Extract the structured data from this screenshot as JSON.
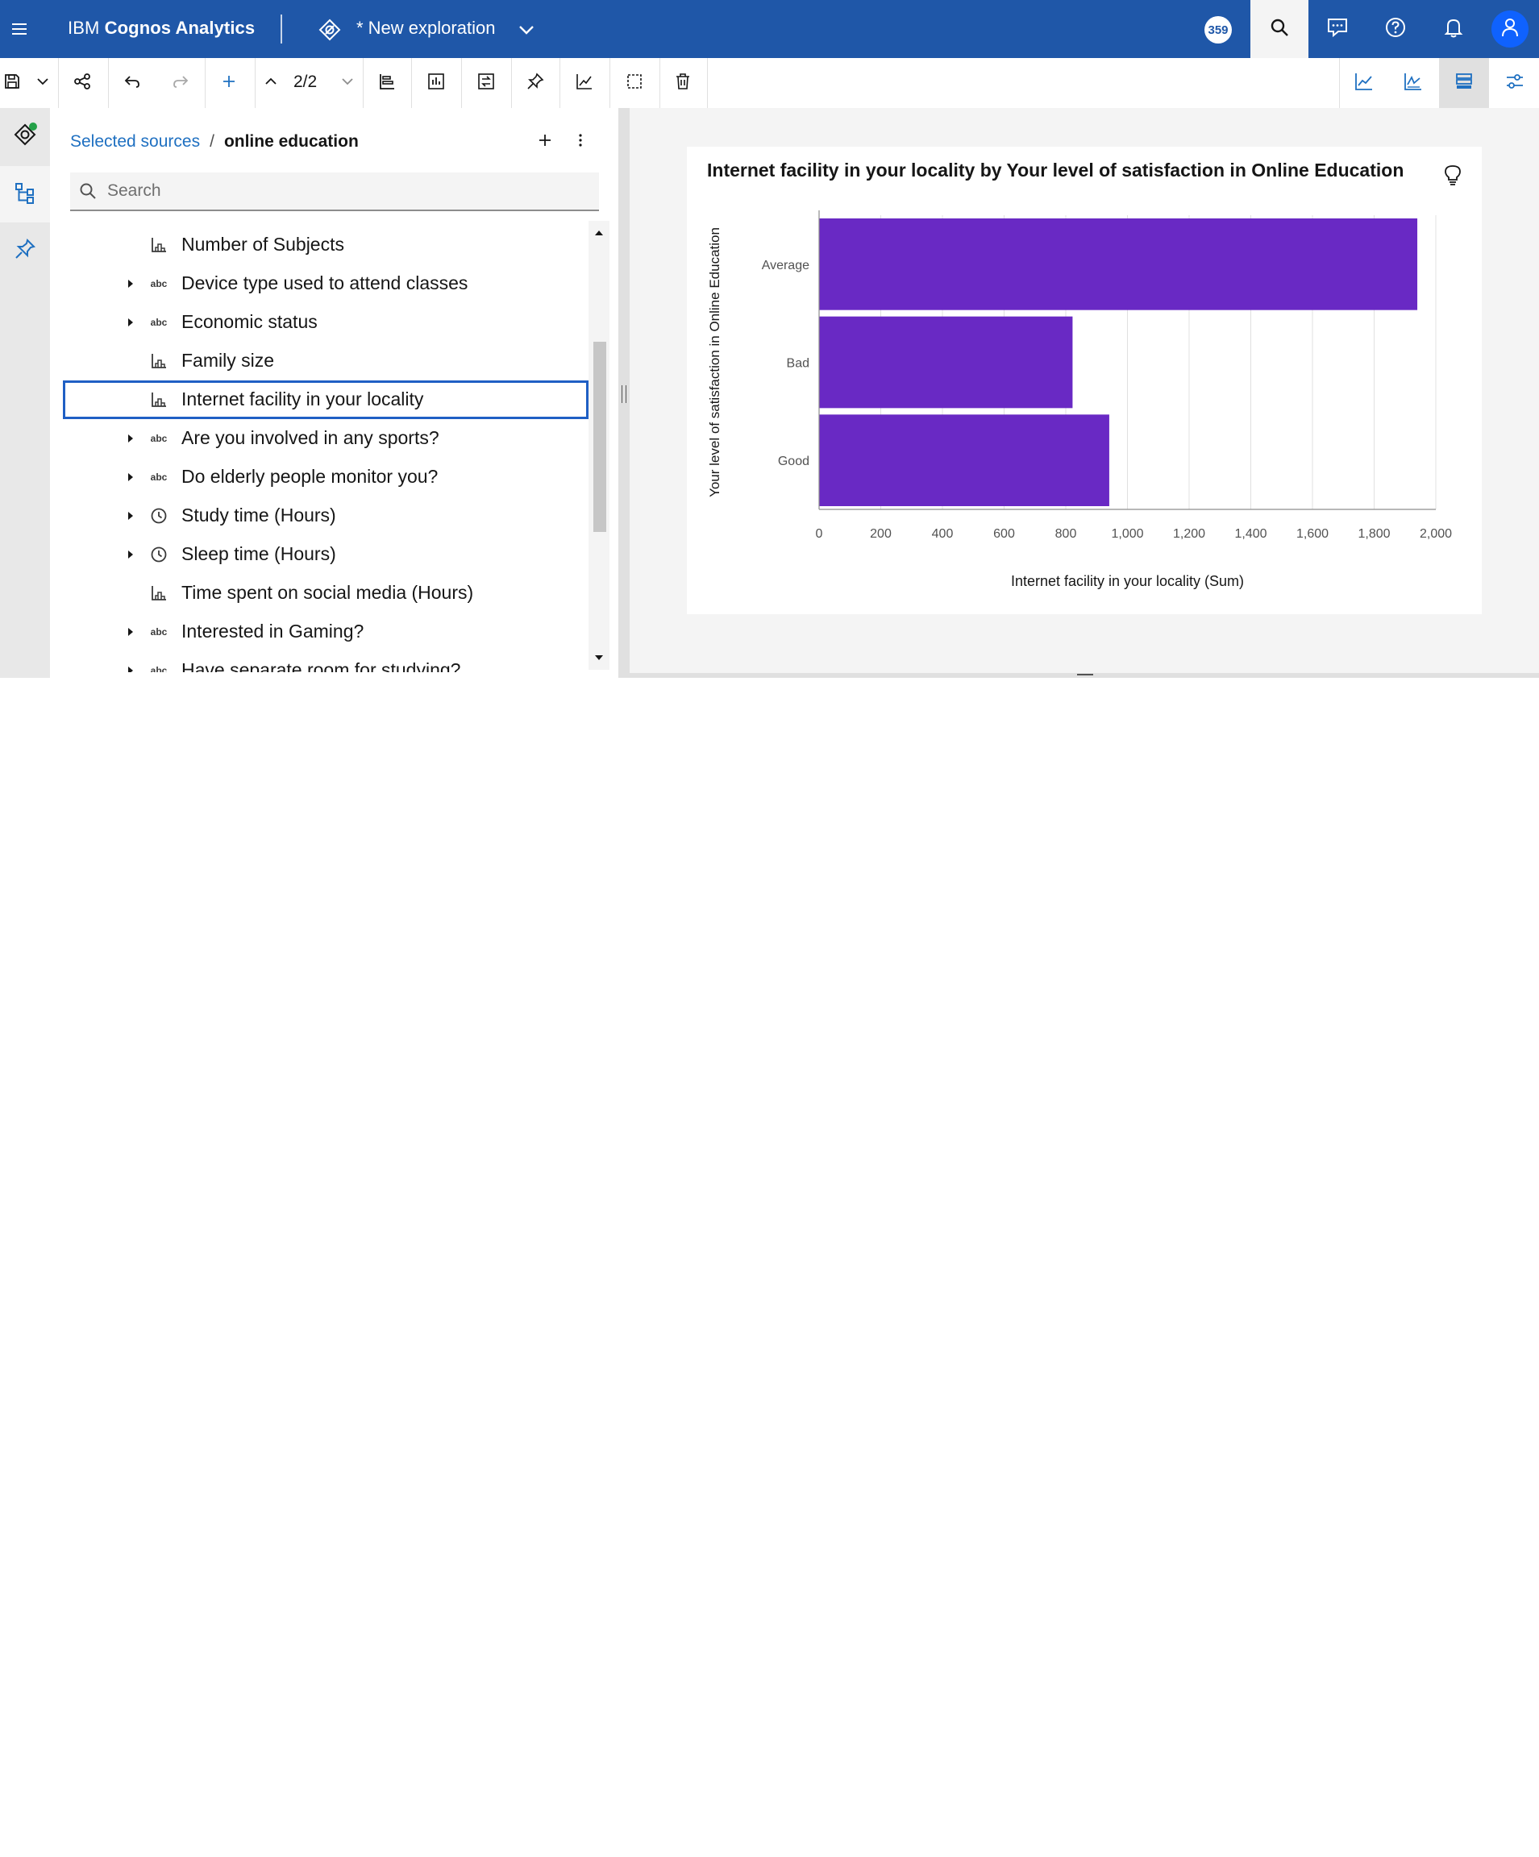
{
  "header": {
    "brand_prefix": "IBM ",
    "brand_name": "Cognos Analytics",
    "exploration_title": "* New exploration",
    "badge": "359"
  },
  "toolbar": {
    "pager": "2/2"
  },
  "source_panel": {
    "breadcrumb_link": "Selected sources",
    "breadcrumb_sep": "/",
    "breadcrumb_current": "online education",
    "search_placeholder": "Search",
    "items": [
      {
        "label": "Number of Subjects",
        "icon": "measure-icon",
        "expandable": false,
        "selected": false
      },
      {
        "label": "Device type used to attend classes",
        "icon": "abc",
        "expandable": true,
        "selected": false
      },
      {
        "label": "Economic status",
        "icon": "abc",
        "expandable": true,
        "selected": false
      },
      {
        "label": "Family size",
        "icon": "measure-icon",
        "expandable": false,
        "selected": false
      },
      {
        "label": "Internet facility in your locality",
        "icon": "measure-icon",
        "expandable": false,
        "selected": true
      },
      {
        "label": "Are you involved in any sports?",
        "icon": "abc",
        "expandable": true,
        "selected": false
      },
      {
        "label": "Do elderly people monitor you?",
        "icon": "abc",
        "expandable": true,
        "selected": false
      },
      {
        "label": "Study time (Hours)",
        "icon": "clock-icon",
        "expandable": true,
        "selected": false
      },
      {
        "label": "Sleep time (Hours)",
        "icon": "clock-icon",
        "expandable": true,
        "selected": false
      },
      {
        "label": "Time spent on social media (Hours)",
        "icon": "measure-icon",
        "expandable": false,
        "selected": false
      },
      {
        "label": "Interested in Gaming?",
        "icon": "abc",
        "expandable": true,
        "selected": false
      },
      {
        "label": "Have separate room for studying?",
        "icon": "abc",
        "expandable": true,
        "selected": false
      }
    ]
  },
  "colors": {
    "header_bg": "#1f57a8",
    "bar": "#6929c4",
    "link": "#1f70c1",
    "selection": "#1f5fc4"
  },
  "chart_data": {
    "type": "bar",
    "orientation": "horizontal",
    "title": "Internet facility in your locality by Your level of satisfaction in Online Education",
    "xlabel": "Internet facility in your locality (Sum)",
    "ylabel": "Your level of satisfaction in Online Education",
    "categories": [
      "Average",
      "Bad",
      "Good"
    ],
    "values": [
      1940,
      822,
      941
    ],
    "xlim": [
      0,
      2000
    ],
    "xticks": [
      0,
      200,
      400,
      600,
      800,
      1000,
      1200,
      1400,
      1600,
      1800,
      2000
    ],
    "xtick_labels": [
      "0",
      "200",
      "400",
      "600",
      "800",
      "1,000",
      "1,200",
      "1,400",
      "1,600",
      "1,800",
      "2,000"
    ],
    "grid": true,
    "legend": "none"
  }
}
